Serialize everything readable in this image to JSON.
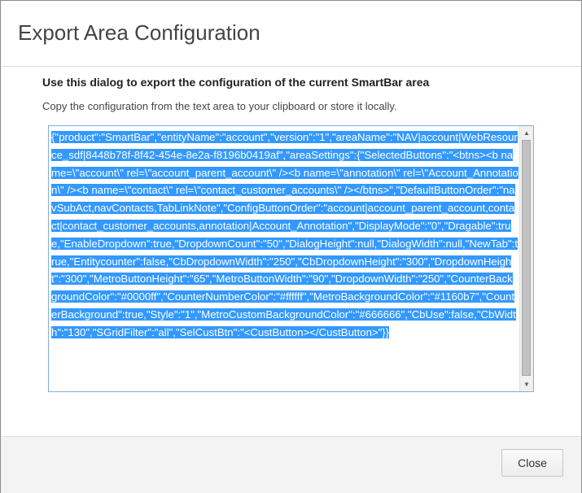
{
  "dialog": {
    "title": "Export Area Configuration",
    "heading": "Use this dialog to export the configuration of the current SmartBar area",
    "description": "Copy the configuration from the text area to your clipboard or store it locally.",
    "config_text": "{\"product\":\"SmartBar\",\"entityName\":\"account\",\"version\":\"1\",\"areaName\":\"NAV|account|WebResource_sdf|8448b78f-8f42-454e-8e2a-f8196b0419af\",\"areaSettings\":{\"SelectedButtons\":\"<btns><b name=\\\"account\\\" rel=\\\"account_parent_account\\\" /><b name=\\\"annotation\\\" rel=\\\"Account_Annotation\\\" /><b name=\\\"contact\\\" rel=\\\"contact_customer_accounts\\\" /></btns>\",\"DefaultButtonOrder\":\"navSubAct,navContacts,TabLinkNote\",\"ConfigButtonOrder\":\"account|account_parent_account,contact|contact_customer_accounts,annotation|Account_Annotation\",\"DisplayMode\":\"0\",\"Dragable\":true,\"EnableDropdown\":true,\"DropdownCount\":\"50\",\"DialogHeight\":null,\"DialogWidth\":null,\"NewTab\":true,\"Entitycounter\":false,\"CbDropdownWidth\":\"250\",\"CbDropdownHeight\":\"300\",\"DropdownHeight\":\"300\",\"MetroButtonHeight\":\"65\",\"MetroButtonWidth\":\"90\",\"DropdownWidth\":\"250\",\"CounterBackgroundColor\":\"#0000ff\",\"CounterNumberColor\":\"#ffffff\",\"MetroBackgroundColor\":\"#1160b7\",\"CounterBackground\":true,\"Style\":\"1\",\"MetroCustomBackgroundColor\":\"#666666\",\"CbUse\":false,\"CbWidth\":\"130\",\"SGridFilter\":\"all\",\"SelCustBtn\":\"<CustButton></CustButton>\"}}",
    "close_label": "Close"
  },
  "colors": {
    "selection": "#3399ff",
    "textarea_border": "#7fb0e0",
    "footer_bg": "#f3f3f3"
  },
  "icons": {
    "scroll_up": "triangle-up-icon",
    "scroll_down": "triangle-down-icon"
  }
}
